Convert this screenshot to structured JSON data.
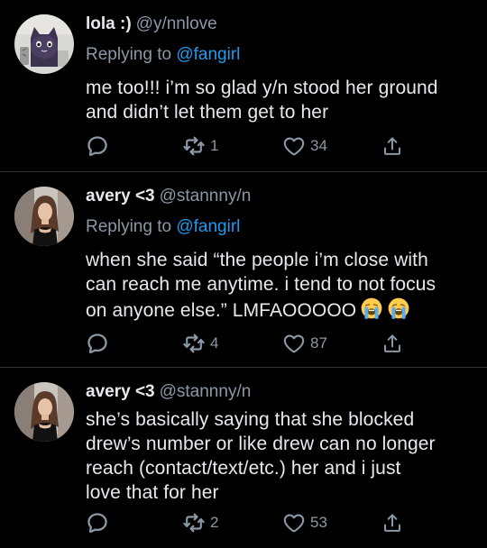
{
  "colors": {
    "background": "#000000",
    "text": "#e7e9ea",
    "secondary": "#8b98a5",
    "accent": "#1d9bf0",
    "divider": "#2f3336"
  },
  "tweets": [
    {
      "name": "lola :)",
      "handle": "@y/nnlove",
      "replying_prefix": "Replying to",
      "replying_to": "@fangirl",
      "lines": [
        "me too!!! i’m so glad y/n stood her ground",
        "and didn’t let them get to her"
      ],
      "retweets": "1",
      "likes": "34",
      "avatar_icon": "cat-plush-avatar"
    },
    {
      "name": "avery <3",
      "handle": "@stannny/n",
      "replying_prefix": "Replying to",
      "replying_to": "@fangirl",
      "lines": [
        "when she said “the people i’m close with",
        "can reach me anytime. i tend to not focus",
        "on anyone else.” LMFAOOOOO"
      ],
      "emoji": "loudly-crying-face-emoji",
      "retweets": "4",
      "likes": "87",
      "avatar_icon": "woman-portrait-avatar"
    },
    {
      "name": "avery <3",
      "handle": "@stannny/n",
      "lines": [
        "she’s basically saying that she blocked",
        "drew’s number or like drew can no longer",
        "reach (contact/text/etc.) her and i just",
        "love that for her"
      ],
      "retweets": "2",
      "likes": "53",
      "avatar_icon": "woman-portrait-avatar"
    }
  ]
}
